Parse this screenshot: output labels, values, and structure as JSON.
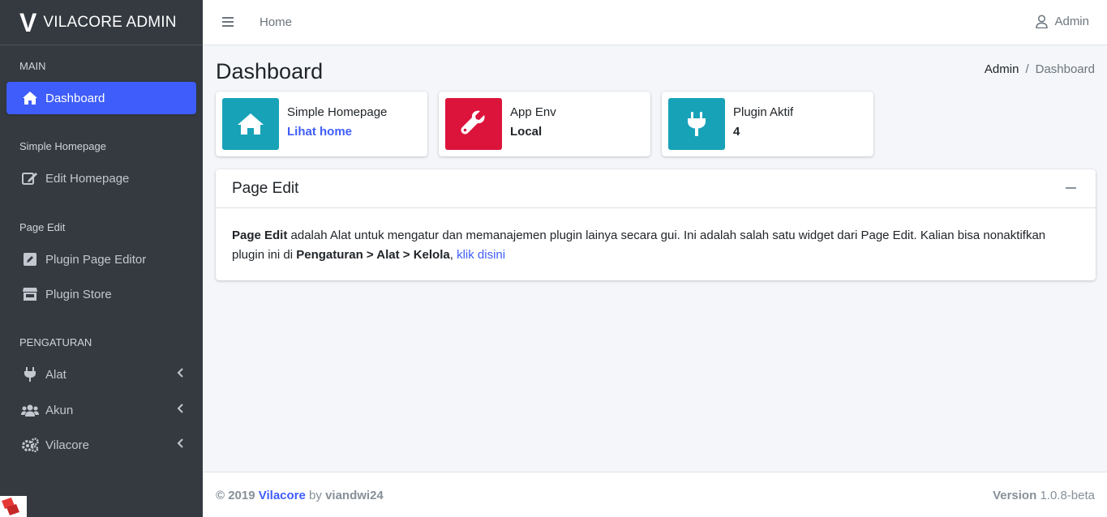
{
  "brand": {
    "logo": "V",
    "name": "VILACORE ADMIN"
  },
  "sidebar": {
    "sections": [
      {
        "header": "MAIN"
      },
      {
        "header": "Simple Homepage"
      },
      {
        "header": "Page Edit"
      },
      {
        "header": "PENGATURAN"
      }
    ],
    "items": [
      {
        "label": "Dashboard",
        "icon": "home-icon",
        "active": true
      },
      {
        "label": "Edit Homepage",
        "icon": "edit-icon"
      },
      {
        "label": "Plugin Page Editor",
        "icon": "pen-square-icon"
      },
      {
        "label": "Plugin Store",
        "icon": "store-icon"
      },
      {
        "label": "Alat",
        "icon": "plug-icon"
      },
      {
        "label": "Akun",
        "icon": "users-icon"
      },
      {
        "label": "Vilacore",
        "icon": "cogs-icon"
      }
    ]
  },
  "topbar": {
    "home": "Home",
    "user": "Admin"
  },
  "page": {
    "title": "Dashboard"
  },
  "breadcrumb": {
    "link": "Admin",
    "separator": "/",
    "current": "Dashboard"
  },
  "info_boxes": [
    {
      "text": "Simple Homepage",
      "value": "Lihat home",
      "icon": "home-icon",
      "color": "#17a2b8"
    },
    {
      "text": "App Env",
      "value": "Local",
      "icon": "wrench-icon",
      "color": "#dc143c"
    },
    {
      "text": "Plugin Aktif",
      "value": "4",
      "icon": "plug-icon",
      "color": "#17a2b8"
    }
  ],
  "card": {
    "title": "Page Edit",
    "bold1": "Page Edit",
    "text1": " adalah Alat untuk mengatur dan memanajemen plugin lainya secara gui. Ini adalah salah satu widget dari Page Edit. Kalian bisa nonaktifkan plugin ini di ",
    "bold2": "Pengaturan > Alat > Kelola",
    "text2": ", ",
    "link": "klik disini"
  },
  "footer": {
    "copyright": "© 2019",
    "brand": "Vilacore",
    "by": "by",
    "author": "viandwi24",
    "version_label": "Version",
    "version": "1.0.8-beta"
  },
  "colors": {
    "accent": "#3f5dfa",
    "sidebar_bg": "#343a40",
    "info": "#17a2b8",
    "danger": "#dc143c"
  }
}
